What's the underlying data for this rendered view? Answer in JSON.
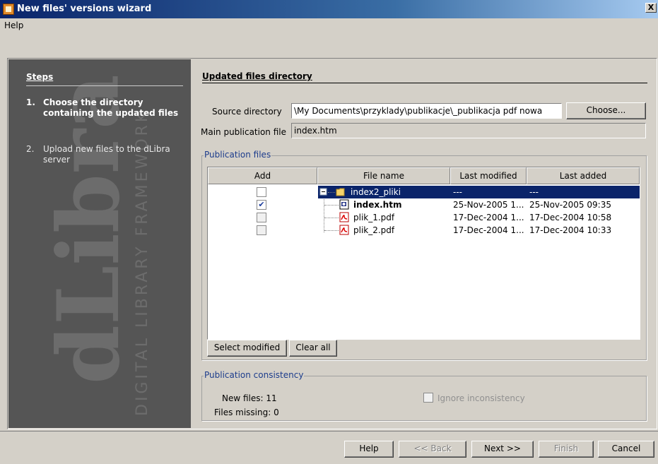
{
  "window": {
    "title": "New files' versions wizard",
    "close_glyph": "X"
  },
  "menu": {
    "help": "Help"
  },
  "sidebar": {
    "heading": "Steps",
    "steps": [
      {
        "number": "1.",
        "label": "Choose the directory containing the updated files",
        "active": true
      },
      {
        "number": "2.",
        "label": "Upload new files to the dLibra server",
        "active": false
      }
    ],
    "watermark_logo": "dLibra",
    "watermark_text": "DIGITAL LIBRARY FRAMEWORK"
  },
  "page": {
    "section_title": "Updated files directory",
    "source_directory_label": "Source directory",
    "source_directory_value": "\\My Documents\\przyklady\\publikacje\\_publikacja pdf nowa",
    "choose_button": "Choose...",
    "main_file_label": "Main publication file",
    "main_file_value": "index.htm",
    "publication_files_label": "Publication files",
    "table": {
      "columns": [
        "Add",
        "File name",
        "Last modified",
        "Last added"
      ],
      "rows": [
        {
          "checked": false,
          "name": "index2_pliki",
          "type": "folder",
          "last_modified": "---",
          "last_added": "---",
          "selected": true
        },
        {
          "checked": true,
          "name": "index.htm",
          "type": "html",
          "last_modified": "25-Nov-2005 1...",
          "last_added": "25-Nov-2005 09:35",
          "selected": false
        },
        {
          "checked": false,
          "name": "plik_1.pdf",
          "type": "pdf",
          "last_modified": "17-Dec-2004 1...",
          "last_added": "17-Dec-2004 10:58",
          "selected": false
        },
        {
          "checked": false,
          "name": "plik_2.pdf",
          "type": "pdf",
          "last_modified": "17-Dec-2004 1...",
          "last_added": "17-Dec-2004 10:33",
          "selected": false
        }
      ]
    },
    "select_modified_button": "Select modified",
    "clear_all_button": "Clear all",
    "consistency": {
      "label": "Publication consistency",
      "new_files": "New files: 11",
      "files_missing": "Files missing: 0",
      "ignore_label": "Ignore inconsistency"
    }
  },
  "footer": {
    "help": "Help",
    "back": "<< Back",
    "next": "Next >>",
    "finish": "Finish",
    "cancel": "Cancel"
  }
}
